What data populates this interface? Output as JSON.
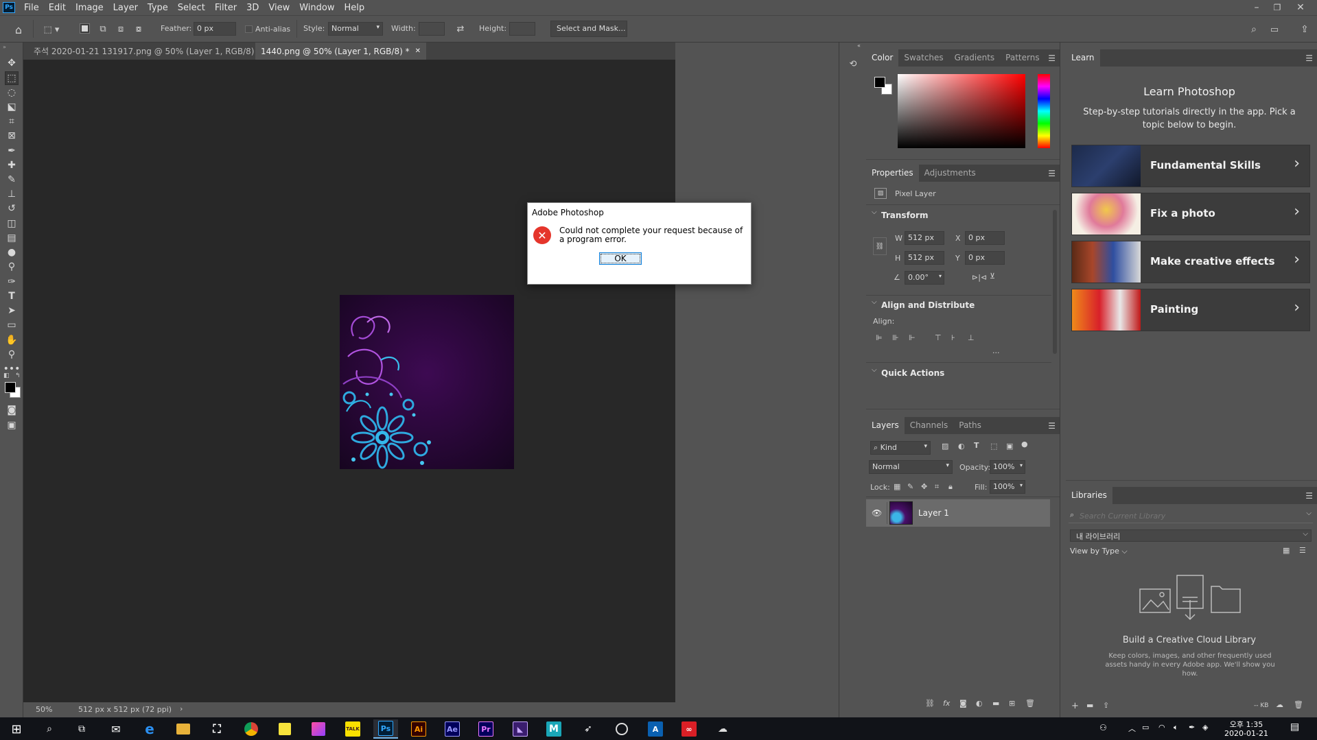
{
  "app": {
    "logo": "Ps"
  },
  "menu": [
    "File",
    "Edit",
    "Image",
    "Layer",
    "Type",
    "Select",
    "Filter",
    "3D",
    "View",
    "Window",
    "Help"
  ],
  "options": {
    "feather_label": "Feather:",
    "feather_value": "0 px",
    "anti_alias_label": "Anti-alias",
    "style_label": "Style:",
    "style_value": "Normal",
    "width_label": "Width:",
    "height_label": "Height:",
    "select_mask_label": "Select and Mask..."
  },
  "doc_tabs": [
    {
      "label": "주석 2020-01-21 131917.png @ 50% (Layer 1, RGB/8)"
    },
    {
      "label": "1440.png @ 50% (Layer 1, RGB/8) *"
    }
  ],
  "status": {
    "zoom": "50%",
    "doc_info": "512 px x 512 px (72 ppi)"
  },
  "dialog": {
    "title": "Adobe Photoshop",
    "message": "Could not complete your request because of a program error.",
    "ok_label": "OK"
  },
  "color_panel": {
    "tabs": [
      "Color",
      "Swatches",
      "Gradients",
      "Patterns"
    ],
    "foreground": "#000000",
    "background": "#ffffff"
  },
  "properties": {
    "tabs": [
      "Properties",
      "Adjustments"
    ],
    "layer_type": "Pixel Layer",
    "transform_title": "Transform",
    "w_label": "W",
    "w_value": "512 px",
    "h_label": "H",
    "h_value": "512 px",
    "x_label": "X",
    "x_value": "0 px",
    "y_label": "Y",
    "y_value": "0 px",
    "angle_value": "0.00°",
    "align_title": "Align and Distribute",
    "align_label": "Align:",
    "more": "...",
    "quick_actions_title": "Quick Actions"
  },
  "layers": {
    "tabs": [
      "Layers",
      "Channels",
      "Paths"
    ],
    "filter_kind": "Kind",
    "blend_mode": "Normal",
    "opacity_label": "Opacity:",
    "opacity_value": "100%",
    "lock_label": "Lock:",
    "fill_label": "Fill:",
    "fill_value": "100%",
    "items": [
      {
        "name": "Layer 1"
      }
    ]
  },
  "learn": {
    "tab": "Learn",
    "title": "Learn Photoshop",
    "subtitle": "Step-by-step tutorials directly in the app. Pick a topic below to begin.",
    "topics": [
      "Fundamental Skills",
      "Fix a photo",
      "Make creative effects",
      "Painting"
    ]
  },
  "libraries": {
    "tab": "Libraries",
    "search_placeholder": "Search Current Library",
    "library_name": "내 라이브러리",
    "view_by": "View by Type",
    "empty_title": "Build a Creative Cloud Library",
    "empty_desc": "Keep colors, images, and other frequently used assets handy in every Adobe app. We'll show you how.",
    "size": "-- KB"
  },
  "taskbar": {
    "apps": [
      "Ai",
      "Ae",
      "Pr",
      "M"
    ],
    "time": "오후 1:35",
    "date": "2020-01-21"
  },
  "colors": {
    "accent_blue": "#1473e6",
    "error_red": "#e81123"
  }
}
